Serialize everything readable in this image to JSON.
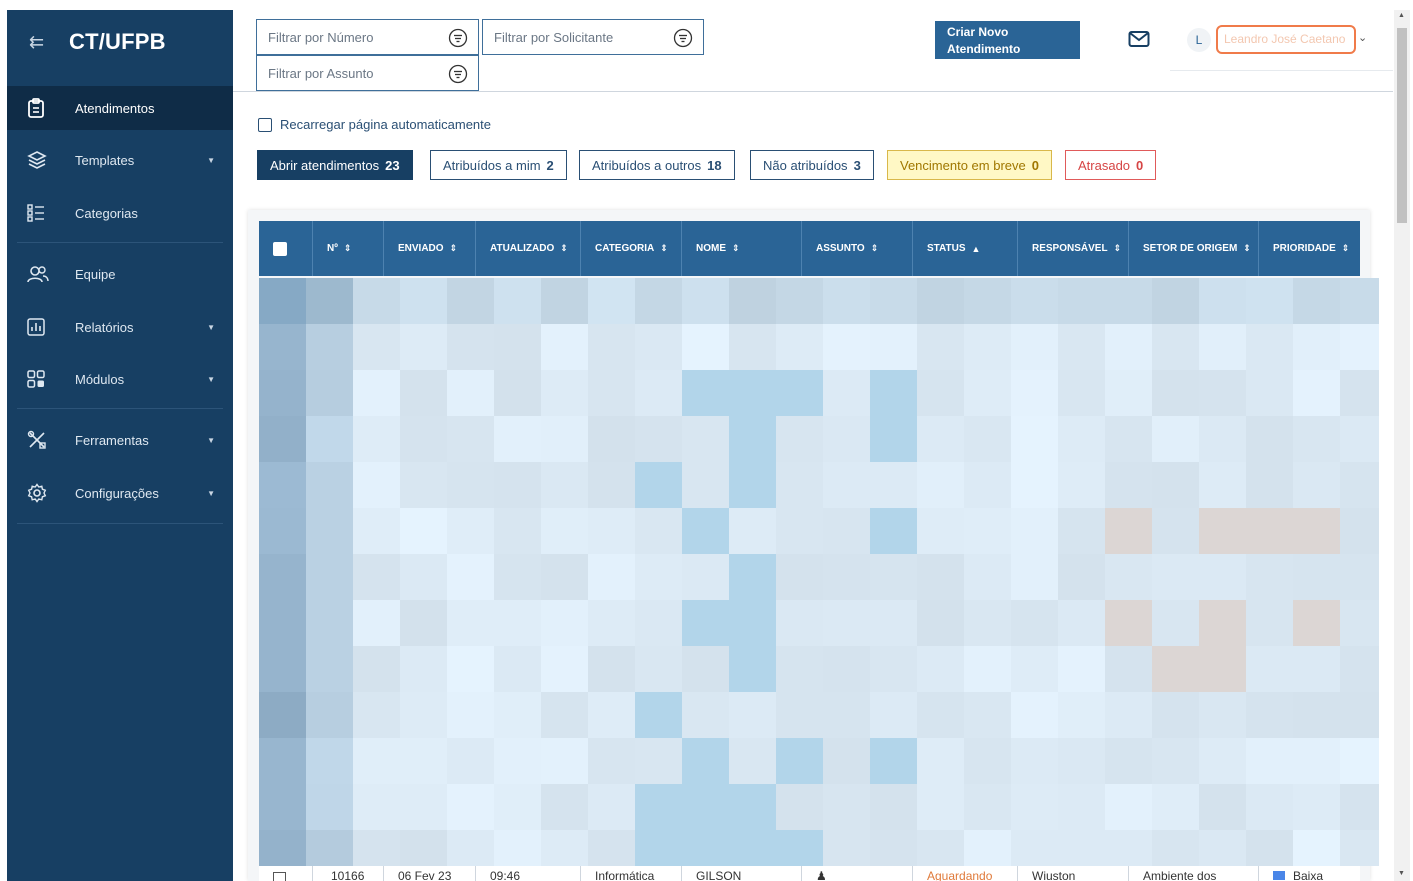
{
  "sidebar": {
    "brand": "CT/UFPB",
    "items": [
      {
        "label": "Atendimentos",
        "icon": "clipboard-icon",
        "active": true
      },
      {
        "label": "Templates",
        "icon": "layers-icon",
        "has_submenu": true
      },
      {
        "label": "Categorias",
        "icon": "list-icon"
      },
      {
        "label": "Equipe",
        "icon": "users-icon"
      },
      {
        "label": "Relatórios",
        "icon": "chart-icon",
        "has_submenu": true
      },
      {
        "label": "Módulos",
        "icon": "grid-icon",
        "has_submenu": true
      },
      {
        "label": "Ferramentas",
        "icon": "tools-icon",
        "has_submenu": true
      },
      {
        "label": "Configurações",
        "icon": "gear-icon",
        "has_submenu": true
      }
    ]
  },
  "filters": {
    "numero_placeholder": "Filtrar por Número",
    "solicitante_placeholder": "Filtrar por Solicitante",
    "assunto_placeholder": "Filtrar por Assunto"
  },
  "header": {
    "new_button_line1": "Criar Novo",
    "new_button_line2": "Atendimento",
    "avatar_initial": "L",
    "user_name": "Leandro José Caetano"
  },
  "reload_label": "Recarregar página automaticamente",
  "tabs": [
    {
      "label": "Abrir atendimentos",
      "count": "23"
    },
    {
      "label": "Atribuídos a mim",
      "count": "2"
    },
    {
      "label": "Atribuídos a outros",
      "count": "18"
    },
    {
      "label": "Não atribuídos",
      "count": "3"
    },
    {
      "label": "Vencimento em breve",
      "count": "0"
    },
    {
      "label": "Atrasado",
      "count": "0"
    }
  ],
  "table": {
    "columns": [
      "Nº",
      "ENVIADO",
      "ATUALIZADO",
      "CATEGORIA",
      "NOME",
      "ASSUNTO",
      "STATUS",
      "RESPONSÁVEL",
      "SETOR DE ORIGEM",
      "PRIORIDADE"
    ],
    "peek_row": [
      "10166",
      "06 Fev 23",
      "09:46",
      "Informática",
      "GILSON",
      "",
      "Aguardando",
      "Wiuston",
      "Ambiente dos",
      "Baixa"
    ]
  },
  "colors": {
    "sidebar": "#173f63",
    "table_header": "#2a6496",
    "status_waiting": "#e07a3a",
    "priority_low": "#4a86e8"
  }
}
